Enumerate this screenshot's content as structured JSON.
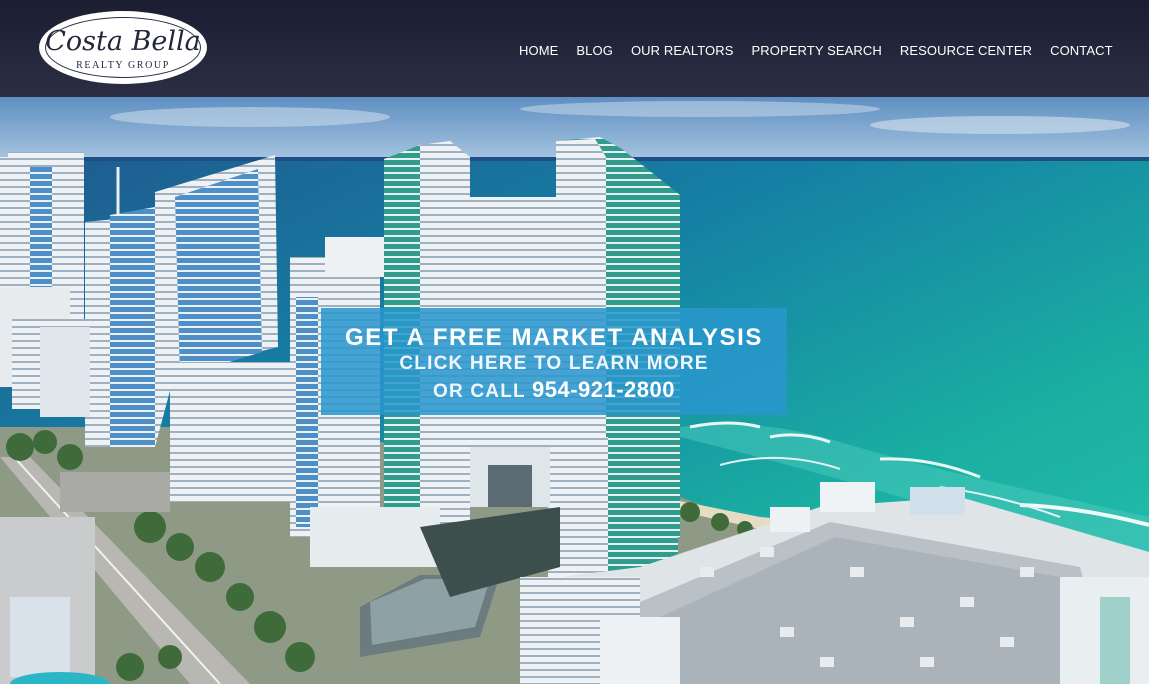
{
  "brand": {
    "script": "Costa Bella",
    "subtitle": "REALTY GROUP"
  },
  "nav": {
    "items": [
      {
        "label": "HOME"
      },
      {
        "label": "BLOG"
      },
      {
        "label": "OUR REALTORS"
      },
      {
        "label": "PROPERTY SEARCH"
      },
      {
        "label": "RESOURCE CENTER"
      },
      {
        "label": "CONTACT"
      }
    ]
  },
  "cta": {
    "title": "GET A FREE MARKET ANALYSIS",
    "line2": "CLICK HERE TO LEARN MORE",
    "line3_prefix": "OR CALL",
    "phone": "954-921-2800"
  },
  "colors": {
    "header_bg": "#24273c",
    "cta_bg": "#2996cd",
    "ocean": "#1aa7a0",
    "sky": "#6f9ecb"
  }
}
